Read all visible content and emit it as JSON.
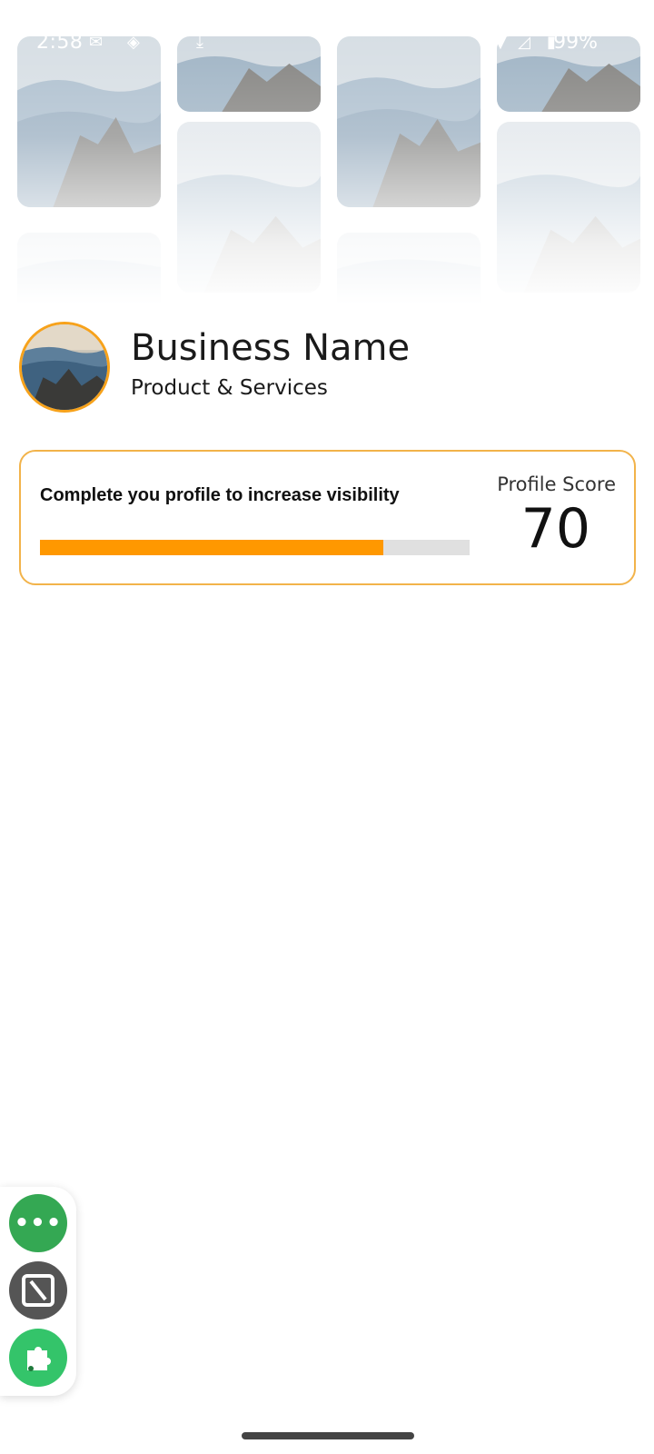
{
  "status_bar": {
    "time": "2:58",
    "battery": "99%"
  },
  "profile": {
    "business_name": "Business Name",
    "category": "Product & Services"
  },
  "score_card": {
    "message": "Complete you profile to increase visibility",
    "progress_fraction": 0.8,
    "label": "Profile Score",
    "value": "70"
  },
  "colors": {
    "accent": "#ff9800",
    "card_border": "#f2b34a",
    "floating_green": "#34a853"
  }
}
